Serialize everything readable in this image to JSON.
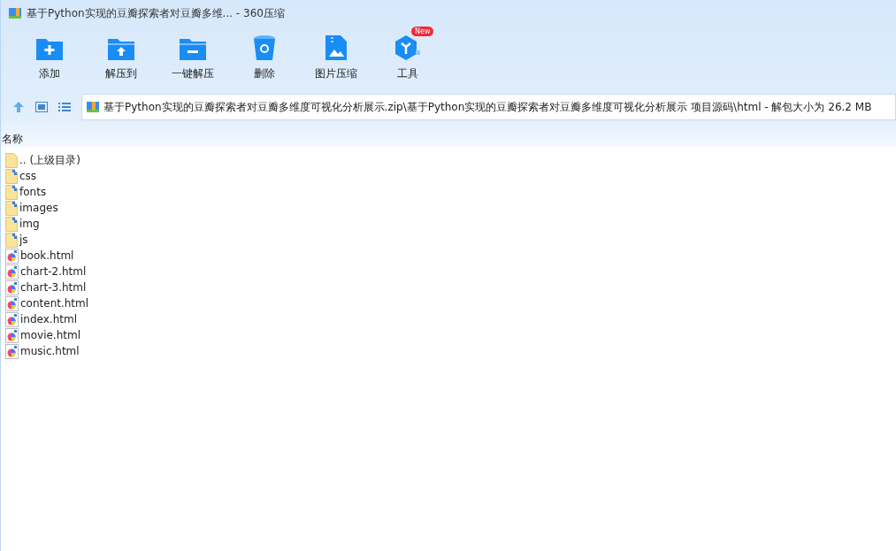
{
  "window": {
    "title": "基于Python实现的豆瓣探索者对豆瓣多维... - 360压缩"
  },
  "toolbar": [
    {
      "kind": "add",
      "label": "添加"
    },
    {
      "kind": "extract-to",
      "label": "解压到"
    },
    {
      "kind": "extract",
      "label": "一键解压"
    },
    {
      "kind": "delete",
      "label": "删除"
    },
    {
      "kind": "image",
      "label": "图片压缩"
    },
    {
      "kind": "tools",
      "label": "工具",
      "badge": "New"
    }
  ],
  "path_bar": {
    "path": "基于Python实现的豆瓣探索者对豆瓣多维度可视化分析展示.zip\\基于Python实现的豆瓣探索者对豆瓣多维度可视化分析展示 项目源码\\html - 解包大小为 26.2 MB"
  },
  "table": {
    "columns": [
      "名称"
    ],
    "rows": [
      {
        "kind": "parent",
        "name": ".. (上级目录)"
      },
      {
        "kind": "folder",
        "name": "css"
      },
      {
        "kind": "folder",
        "name": "fonts"
      },
      {
        "kind": "folder",
        "name": "images"
      },
      {
        "kind": "folder",
        "name": "img"
      },
      {
        "kind": "folder",
        "name": "js"
      },
      {
        "kind": "html",
        "name": "book.html"
      },
      {
        "kind": "html",
        "name": "chart-2.html"
      },
      {
        "kind": "html",
        "name": "chart-3.html"
      },
      {
        "kind": "html",
        "name": "content.html"
      },
      {
        "kind": "html",
        "name": "index.html"
      },
      {
        "kind": "html",
        "name": "movie.html"
      },
      {
        "kind": "html",
        "name": "music.html"
      }
    ]
  }
}
